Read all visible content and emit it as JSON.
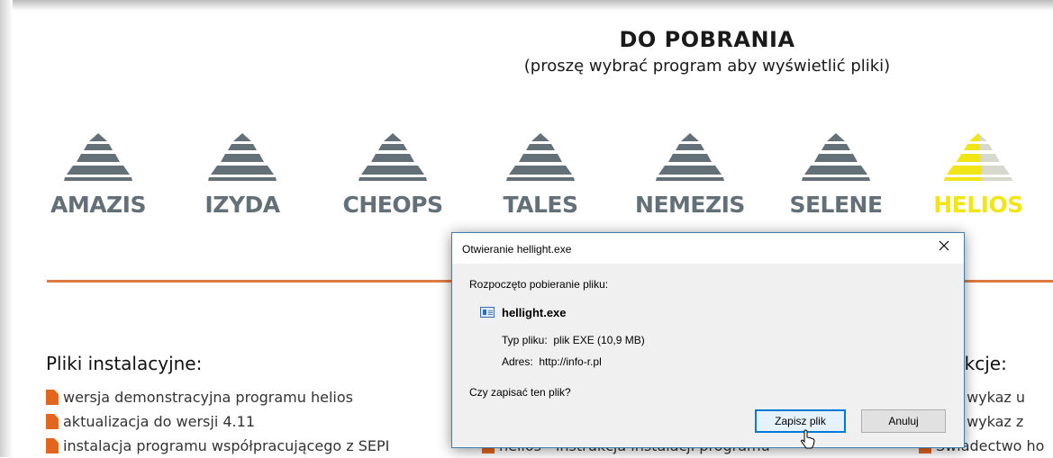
{
  "page": {
    "title": "DO POBRANIA",
    "subtitle": "(proszę wybrać program aby wyświetlić pliki)"
  },
  "programs": [
    {
      "name": "AMAZIS",
      "active": false
    },
    {
      "name": "IZYDA",
      "active": false
    },
    {
      "name": "CHEOPS",
      "active": false
    },
    {
      "name": "TALES",
      "active": false
    },
    {
      "name": "NEMEZIS",
      "active": false
    },
    {
      "name": "SELENE",
      "active": false
    },
    {
      "name": "HELIOS",
      "active": true
    }
  ],
  "colors": {
    "logo_gray": "#647077",
    "logo_active": "#f2e516",
    "accent": "#e07a44",
    "file_icon": "#e2661e",
    "dialog_border": "#0078d7"
  },
  "installers": {
    "title": "Pliki instalacyjne:",
    "items": [
      "wersja demonstracyjna programu helios",
      "aktualizacja do wersji 4.11",
      "instalacja programu współpracującego z SEPI"
    ]
  },
  "middle_list": {
    "items": [
      "helios - instrukcja instalacji programu"
    ]
  },
  "instructions": {
    "title": "ukcje:",
    "items": [
      "os - wykaz u",
      "os - wykaz z",
      "Świadectwo ho"
    ]
  },
  "dialog": {
    "title": "Otwieranie hellight.exe",
    "intro": "Rozpoczęto pobieranie pliku:",
    "file_icon": "exe-file-icon",
    "filename": "hellight.exe",
    "type_label": "Typ pliku:",
    "type_value": "plik EXE (10,9 MB)",
    "address_label": "Adres:",
    "address_value": "http://info-r.pl",
    "question": "Czy zapisać ten plik?",
    "save_label": "Zapisz plik",
    "cancel_label": "Anuluj"
  }
}
